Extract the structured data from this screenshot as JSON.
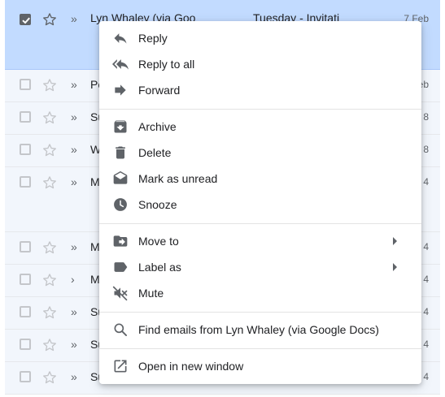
{
  "inbox": {
    "rows": [
      {
        "sender": "Lyn Whaley (via Goo",
        "subject": "Tuesday - Invitati",
        "date": "7 Feb",
        "selected": true
      },
      {
        "sender": "Pe",
        "date": "eb"
      },
      {
        "sender": "Su",
        "date": "8"
      },
      {
        "sender": "W",
        "date": "8"
      },
      {
        "sender": "M",
        "date": "4"
      },
      {
        "sender": "M",
        "date": "4"
      },
      {
        "sender": "M",
        "date": "4"
      },
      {
        "sender": "Su",
        "date": "4"
      },
      {
        "sender": "Su",
        "date": "4"
      },
      {
        "sender": "Su",
        "date": "4"
      }
    ],
    "importance_marker": "»",
    "importance_marker_single": "›"
  },
  "menu": {
    "reply": "Reply",
    "reply_all": "Reply to all",
    "forward": "Forward",
    "archive": "Archive",
    "delete": "Delete",
    "mark_unread": "Mark as unread",
    "snooze": "Snooze",
    "move_to": "Move to",
    "label_as": "Label as",
    "mute": "Mute",
    "find_emails": "Find emails from Lyn Whaley (via Google Docs)",
    "open_new_window": "Open in new window"
  },
  "colors": {
    "selected_row": "#c2dbff",
    "row_bg": "#f2f6fc",
    "icon": "#5f6368",
    "text": "#202124"
  }
}
